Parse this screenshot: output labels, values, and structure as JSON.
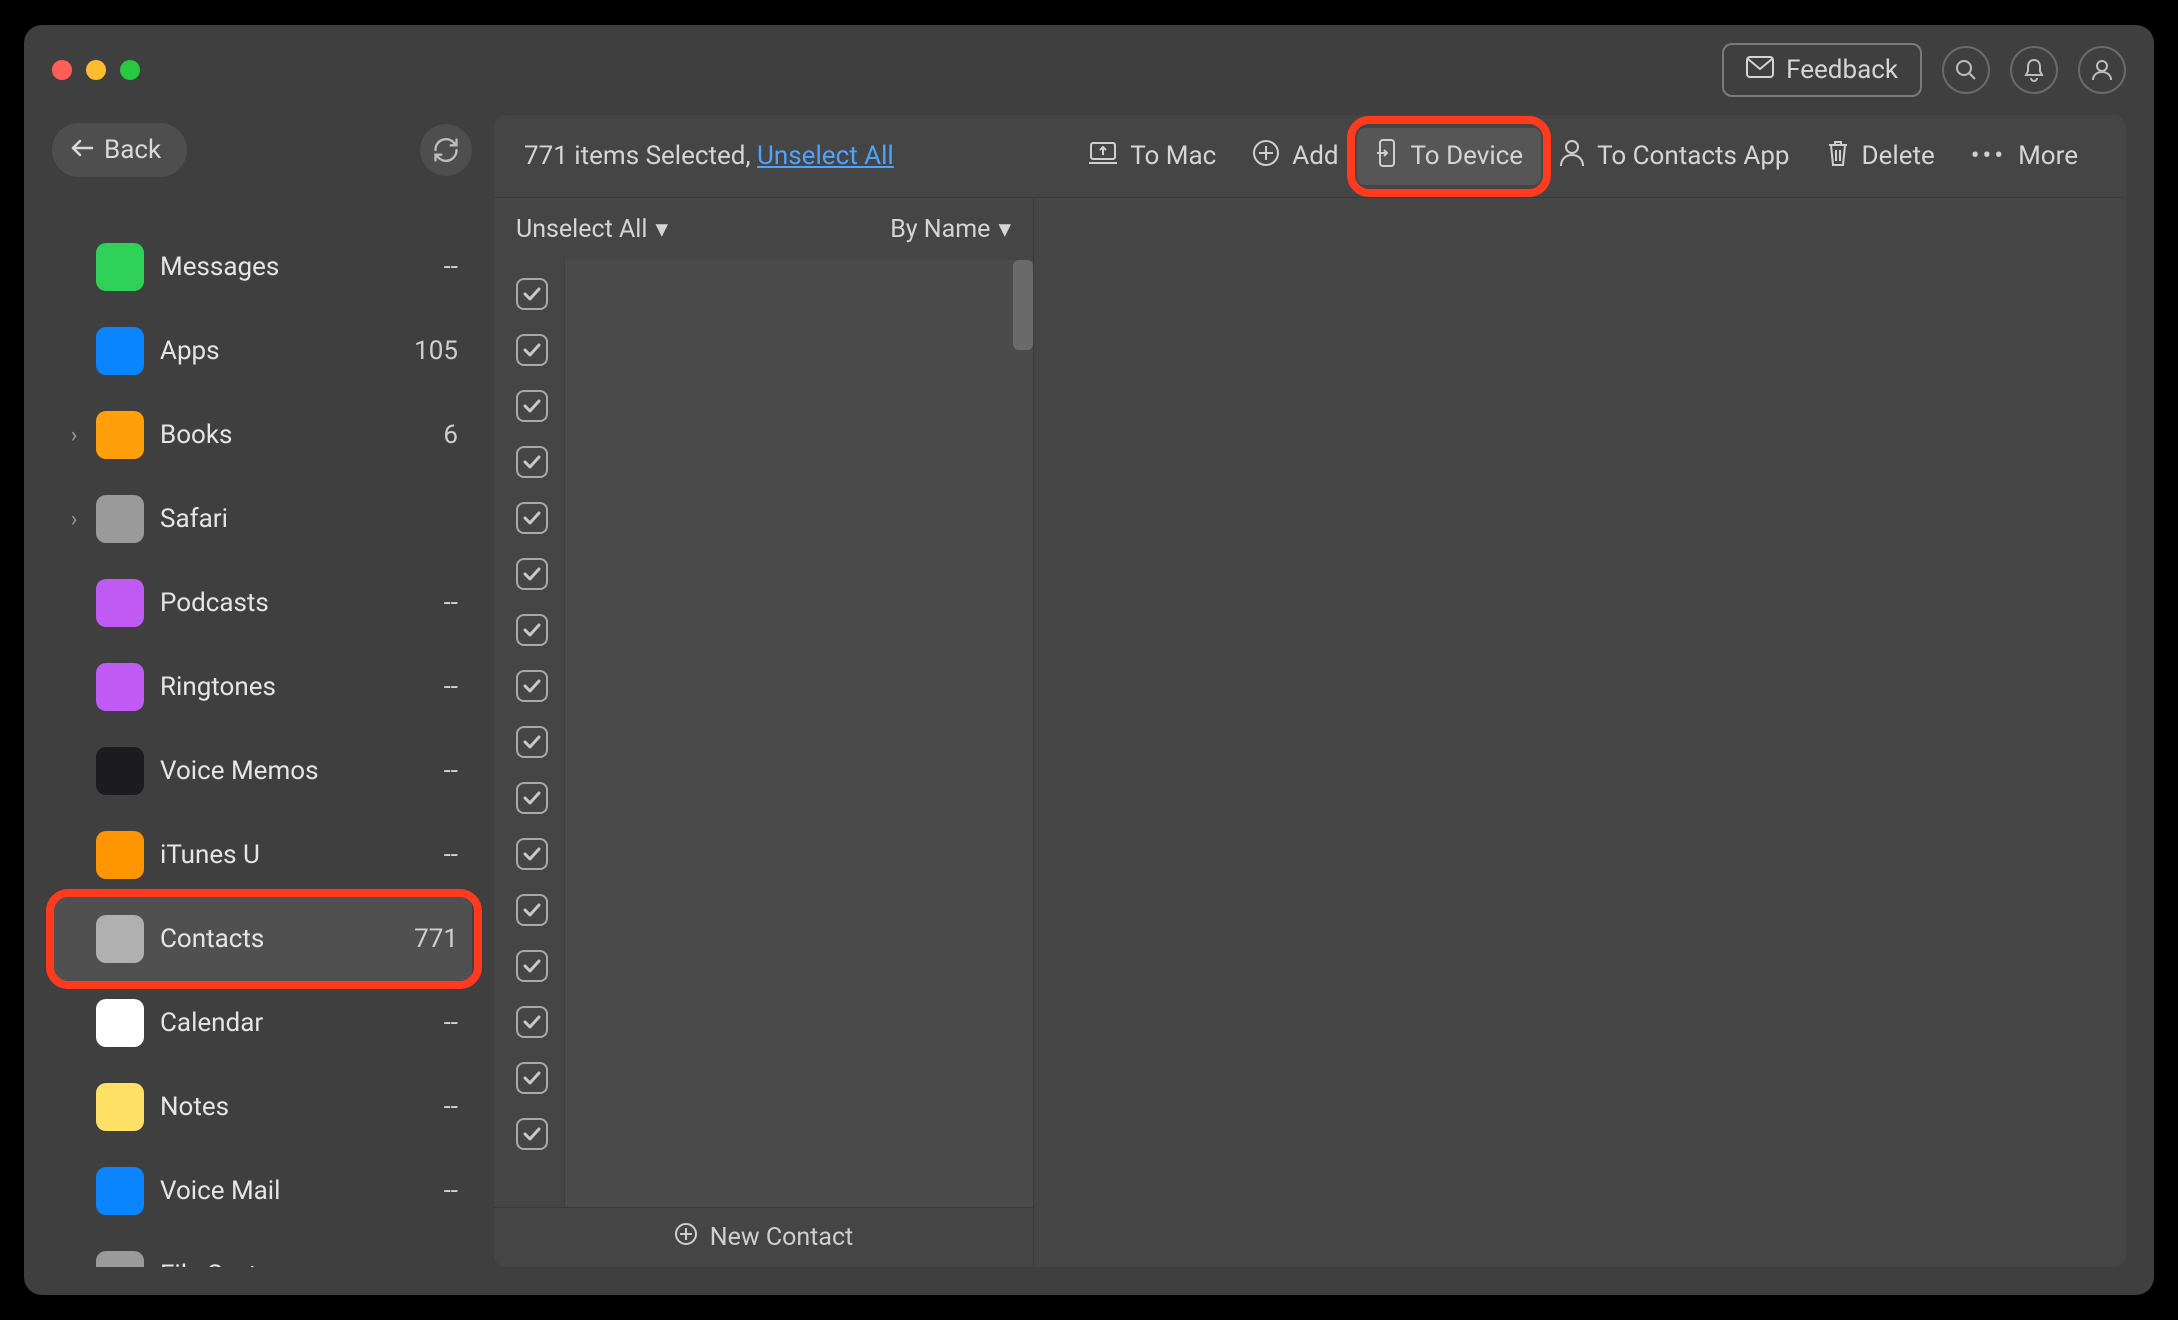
{
  "titlebar": {
    "feedback_label": "Feedback"
  },
  "sidebar": {
    "back_label": "Back",
    "items": [
      {
        "label": "Messages",
        "count": "--",
        "chev": false,
        "icon_bg": "#30d158",
        "icon": "message-icon"
      },
      {
        "label": "Apps",
        "count": "105",
        "chev": false,
        "icon_bg": "#0a84ff",
        "icon": "apps-icon"
      },
      {
        "label": "Books",
        "count": "6",
        "chev": true,
        "icon_bg": "#ff9f0a",
        "icon": "books-icon"
      },
      {
        "label": "Safari",
        "count": "",
        "chev": true,
        "icon_bg": "#9a9a9a",
        "icon": "safari-icon"
      },
      {
        "label": "Podcasts",
        "count": "--",
        "chev": false,
        "icon_bg": "#bf5af2",
        "icon": "podcasts-icon"
      },
      {
        "label": "Ringtones",
        "count": "--",
        "chev": false,
        "icon_bg": "#bf5af2",
        "icon": "ringtones-icon"
      },
      {
        "label": "Voice Memos",
        "count": "--",
        "chev": false,
        "icon_bg": "#1c1c1e",
        "icon": "voice-memos-icon"
      },
      {
        "label": "iTunes U",
        "count": "--",
        "chev": false,
        "icon_bg": "#ff9500",
        "icon": "itunesu-icon"
      },
      {
        "label": "Contacts",
        "count": "771",
        "chev": false,
        "icon_bg": "#b0b0b0",
        "icon": "contacts-icon",
        "selected": true,
        "highlight": true
      },
      {
        "label": "Calendar",
        "count": "--",
        "chev": false,
        "icon_bg": "#ffffff",
        "icon": "calendar-icon"
      },
      {
        "label": "Notes",
        "count": "--",
        "chev": false,
        "icon_bg": "#ffe066",
        "icon": "notes-icon"
      },
      {
        "label": "Voice Mail",
        "count": "--",
        "chev": false,
        "icon_bg": "#0a84ff",
        "icon": "voicemail-icon"
      },
      {
        "label": "File System",
        "count": "",
        "chev": true,
        "icon_bg": "#9a9a9a",
        "icon": "filesystem-icon"
      }
    ]
  },
  "toolbar": {
    "selected_text": "771 items Selected, ",
    "unselect_all": "Unselect All",
    "to_mac": "To Mac",
    "add": "Add",
    "to_device": "To Device",
    "to_contacts_app": "To Contacts App",
    "delete": "Delete",
    "more": "More"
  },
  "list": {
    "unselect_all": "Unselect All",
    "sort_label": "By Name",
    "new_contact": "New Contact",
    "checkbox_count": 16
  },
  "annotation": {
    "color": "#ff3b1f"
  }
}
